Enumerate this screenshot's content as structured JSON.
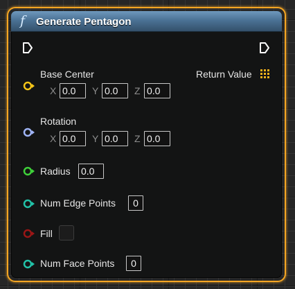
{
  "node": {
    "title": "Generate Pentagon",
    "function_icon": "f",
    "colors": {
      "header": "#4b7295",
      "selection_outline": "#f5a623",
      "vector_pin": "#f5c518",
      "rotator_pin": "#9fb4f5",
      "float_pin": "#3fd13a",
      "int_pin": "#22c2a8",
      "bool_pin": "#9a1616",
      "return_array": "#f6b21b"
    }
  },
  "exec": {
    "input_icon": "exec-in-icon",
    "output_icon": "exec-out-icon"
  },
  "return_value": {
    "label": "Return Value",
    "icon": "array-grid-icon"
  },
  "inputs": {
    "base_center": {
      "label": "Base Center",
      "x_label": "X",
      "x": "0.0",
      "y_label": "Y",
      "y": "0.0",
      "z_label": "Z",
      "z": "0.0"
    },
    "rotation": {
      "label": "Rotation",
      "x_label": "X",
      "x": "0.0",
      "y_label": "Y",
      "y": "0.0",
      "z_label": "Z",
      "z": "0.0"
    },
    "radius": {
      "label": "Radius",
      "value": "0.0"
    },
    "num_edge_points": {
      "label": "Num Edge Points",
      "value": "0"
    },
    "fill": {
      "label": "Fill",
      "checked": false
    },
    "num_face_points": {
      "label": "Num Face Points",
      "value": "0"
    }
  }
}
